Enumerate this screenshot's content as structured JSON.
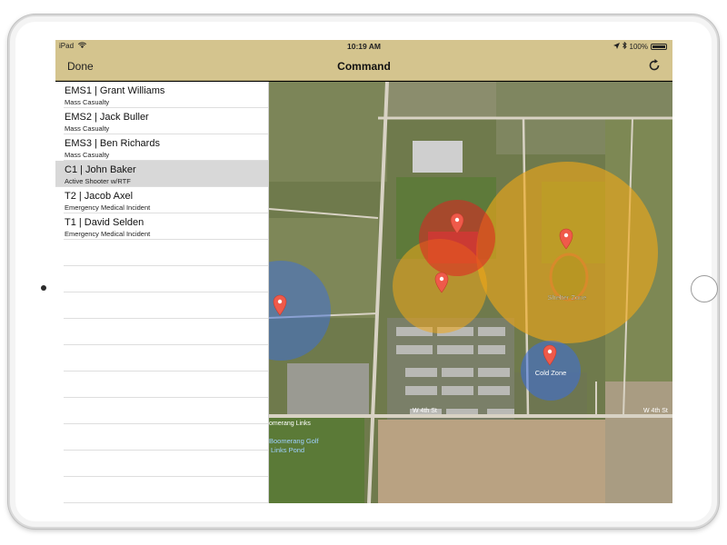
{
  "status": {
    "device": "iPad",
    "time": "10:19 AM",
    "battery": "100%",
    "battery_level": 1.0
  },
  "nav": {
    "done_label": "Done",
    "title": "Command",
    "refresh_icon": "refresh-icon"
  },
  "incidents": [
    {
      "title": "EMS1 | Grant Williams",
      "subtitle": "Mass Casualty",
      "selected": false
    },
    {
      "title": "EMS2 | Jack Buller",
      "subtitle": "Mass Casualty",
      "selected": false
    },
    {
      "title": "EMS3 | Ben Richards",
      "subtitle": "Mass Casualty",
      "selected": false
    },
    {
      "title": "C1 | John Baker",
      "subtitle": "Active Shooter w/RTF",
      "selected": true
    },
    {
      "title": "T2 | Jacob Axel",
      "subtitle": "Emergency Medical Incident",
      "selected": false
    },
    {
      "title": "T1 | David Selden",
      "subtitle": "Emergency Medical Incident",
      "selected": false
    }
  ],
  "map": {
    "zones": [
      {
        "label": "Shelter Zone",
        "color": "#f0a818"
      },
      {
        "label": "Cold Zone",
        "color": "#3a6ee0"
      }
    ],
    "hot_zone_color": "#e22020",
    "warm_zone_color": "#f0a818",
    "street_labels": {
      "w4th_left": "W 4th St",
      "w4th_right": "W 4th St",
      "golf_links": "omerang Links",
      "golf_pond": "Boomerang Golf\nLinks Pond",
      "golf_pond_line1": "Boomerang Golf",
      "golf_pond_line2": "Links Pond"
    },
    "pin_icon": "map-pin-icon"
  },
  "colors": {
    "bar": "#d4c48e",
    "selected_row": "#d8d8d8"
  }
}
